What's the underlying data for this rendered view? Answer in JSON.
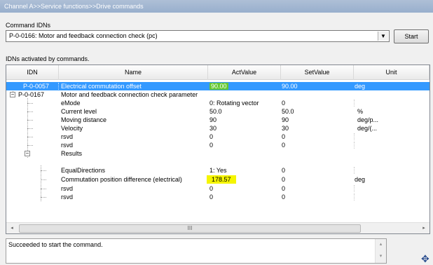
{
  "breadcrumb": "Channel A>>Service functions>>Drive commands",
  "command": {
    "label": "Command IDNs",
    "selected": "P-0-0166: Motor and feedback connection check (pc)",
    "start_label": "Start"
  },
  "activated_label": "IDNs activated by commands.",
  "columns": [
    "IDN",
    "Name",
    "ActValue",
    "SetValue",
    "Unit"
  ],
  "rows": [
    {
      "idn": "P-0-0057",
      "name": "Electrical commutation offset",
      "act": "90.00",
      "set": "90.00",
      "unit": "deg"
    },
    {
      "idn": "P-0-0167",
      "name": "Motor and feedback connection check parameter",
      "act": "",
      "set": "",
      "unit": ""
    },
    {
      "idn": "",
      "name": "eMode",
      "act": "0: Rotating vector",
      "set": "0",
      "unit": ""
    },
    {
      "idn": "",
      "name": "Current level",
      "act": "50.0",
      "set": "50.0",
      "unit": "%"
    },
    {
      "idn": "",
      "name": "Moving distance",
      "act": "90",
      "set": "90",
      "unit": "deg/p..."
    },
    {
      "idn": "",
      "name": "Velocity",
      "act": "30",
      "set": "30",
      "unit": "deg/(..."
    },
    {
      "idn": "",
      "name": "rsvd",
      "act": "0",
      "set": "0",
      "unit": ""
    },
    {
      "idn": "",
      "name": "rsvd",
      "act": "0",
      "set": "0",
      "unit": ""
    },
    {
      "idn": "",
      "name": "Results",
      "act": "",
      "set": "",
      "unit": ""
    },
    {
      "idn": "",
      "name": "EqualDirections",
      "act": "1: Yes",
      "set": "0",
      "unit": ""
    },
    {
      "idn": "",
      "name": "Commutation position difference (electrical)",
      "act": "178.57",
      "set": "0",
      "unit": "deg"
    },
    {
      "idn": "",
      "name": "rsvd",
      "act": "0",
      "set": "0",
      "unit": ""
    },
    {
      "idn": "",
      "name": "rsvd",
      "act": "0",
      "set": "0",
      "unit": ""
    }
  ],
  "tree_toggles": {
    "expanded": "−"
  },
  "scrollbar": {
    "grip": "III",
    "left_arrow": "◂",
    "right_arrow": "▸",
    "up_arrow": "▴",
    "down_arrow": "▾"
  },
  "status_message": "Succeeded to start the command.",
  "icons": {
    "dropdown": "chevron-down-icon",
    "move": "move-icon"
  },
  "colors": {
    "selection": "#3399ff",
    "highlight_yellow": "#f5f500",
    "highlight_green": "#64c832"
  }
}
